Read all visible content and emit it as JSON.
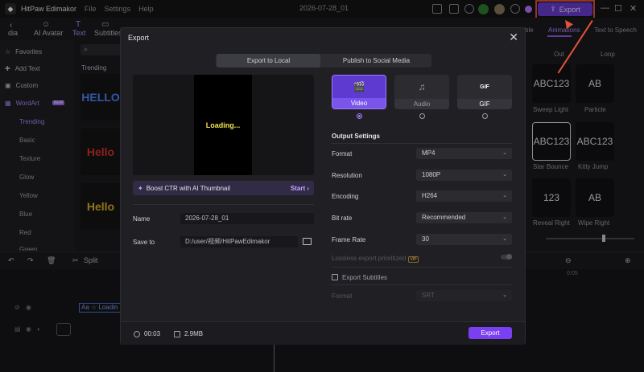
{
  "titlebar": {
    "app_name": "HitPaw Edimakor",
    "menus": [
      "File",
      "Settings",
      "Help"
    ],
    "document_title": "2026-07-28_01",
    "export_label": "Export"
  },
  "toolbar": {
    "items": [
      "dia",
      "AI Avatar",
      "Text",
      "Subtitles"
    ]
  },
  "sidebar": {
    "items": [
      {
        "label": "Favorites"
      },
      {
        "label": "Add Text"
      },
      {
        "label": "Custom"
      },
      {
        "label": "WordArt",
        "badge": "NEW"
      }
    ],
    "subitems": [
      "Trending",
      "Basic",
      "Texture",
      "Glow",
      "Yellow",
      "Blue",
      "Red",
      "Green"
    ]
  },
  "library": {
    "section": "Trending",
    "thumbs": [
      "HELLO",
      "Hello",
      "Hello"
    ]
  },
  "right_panel": {
    "tabs": [
      "ble",
      "Animations",
      "Text to Speech"
    ],
    "subtabs": [
      "Out",
      "Loop"
    ],
    "cards": [
      {
        "text": "ABC123",
        "label": "Sweep Light"
      },
      {
        "text": "AB",
        "label": "Particle"
      },
      {
        "text": "ABC123",
        "label": "Star Bounce"
      },
      {
        "text": "ABC123",
        "label": "Kitty Jump"
      },
      {
        "text": "123",
        "label": "Reveal Right"
      },
      {
        "text": "AB",
        "label": "Wipe Right"
      }
    ]
  },
  "timeline": {
    "split_label": "Split",
    "time_marker": "0:05",
    "clip_label": "Aa ☆ Loadin"
  },
  "export_modal": {
    "title": "Export",
    "tabs": {
      "local": "Export to Local",
      "social": "Publish to Social Media"
    },
    "preview_text": "Loading...",
    "boost": {
      "text": "Boost CTR with AI Thumbnail",
      "action": "Start"
    },
    "name_label": "Name",
    "name_value": "2026-07-28_01",
    "saveto_label": "Save to",
    "saveto_value": "D:/user/视频/HitPawEdimakor",
    "formats": [
      {
        "label": "Video",
        "icon": "🎬"
      },
      {
        "label": "Audio",
        "icon": "♫"
      },
      {
        "label": "GIF",
        "icon": "GIF"
      }
    ],
    "output_settings_title": "Output Settings",
    "settings": {
      "format": {
        "label": "Format",
        "value": "MP4"
      },
      "resolution": {
        "label": "Resolution",
        "value": "1080P"
      },
      "encoding": {
        "label": "Encoding",
        "value": "H264"
      },
      "bitrate": {
        "label": "Bit rate",
        "value": "Recommended"
      },
      "framerate": {
        "label": "Frame Rate",
        "value": "30"
      },
      "lossless": {
        "label": "Lossless export prioritized",
        "badge": "VIP"
      },
      "subtitles": {
        "label": "Export Subtitles"
      },
      "sub_format": {
        "label": "Format",
        "value": "SRT"
      }
    },
    "footer": {
      "duration": "00:03",
      "size": "2.9MB",
      "export_label": "Export"
    }
  }
}
